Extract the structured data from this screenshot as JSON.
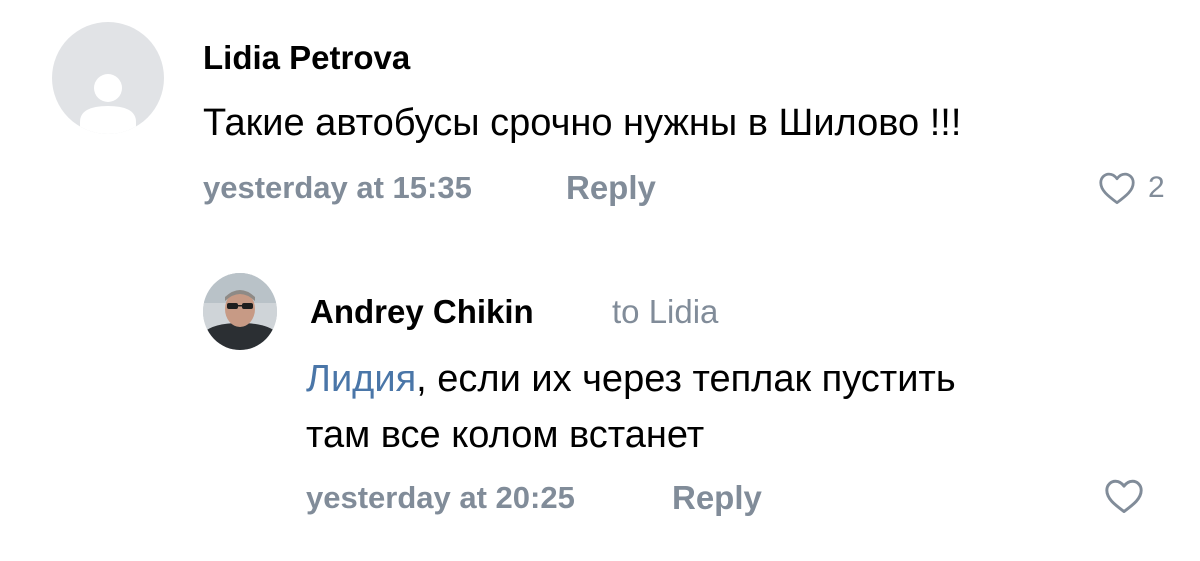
{
  "comments": [
    {
      "author": "Lidia Petrova",
      "text": "Такие автобусы срочно нужны в Шилово !!!",
      "time": "yesterday at 15:35",
      "reply_label": "Reply",
      "likes": "2",
      "avatar_icon": "user-placeholder-icon"
    },
    {
      "author": "Andrey Chikin",
      "to": "to Lidia",
      "mention": "Лидия",
      "text_after_mention": ", если их через теплак пустить",
      "text_line2": "там все колом встанет",
      "time": "yesterday at 20:25",
      "reply_label": "Reply",
      "avatar_icon": "user-photo"
    }
  ],
  "colors": {
    "meta": "#818c99",
    "mention": "#4a76a8",
    "avatar_bg": "#e1e3e6"
  }
}
